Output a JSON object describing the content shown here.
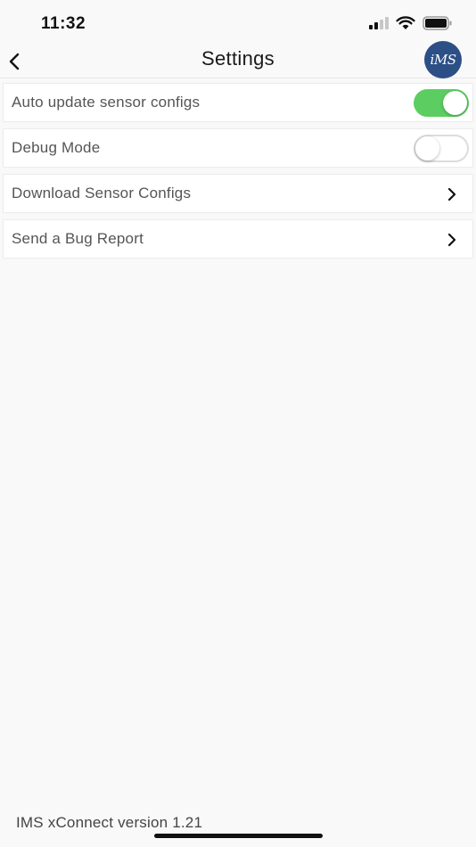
{
  "status_bar": {
    "time": "11:32",
    "signal_icon": "cellular-signal-icon",
    "wifi_icon": "wifi-icon",
    "battery_icon": "battery-icon"
  },
  "nav": {
    "title": "Settings",
    "back_icon": "chevron-left-icon",
    "avatar_text": "iMS"
  },
  "settings": {
    "items": [
      {
        "label": "Auto update sensor configs",
        "control": "toggle",
        "state": "on"
      },
      {
        "label": "Debug Mode",
        "control": "toggle",
        "state": "off"
      },
      {
        "label": "Download Sensor Configs",
        "control": "chevron"
      },
      {
        "label": "Send a Bug Report",
        "control": "chevron"
      }
    ]
  },
  "footer": {
    "version": "IMS xConnect version 1.21"
  },
  "colors": {
    "toggle_on": "#5ccd61",
    "avatar_bg": "#2c4f86",
    "background": "#f9f9f9"
  }
}
